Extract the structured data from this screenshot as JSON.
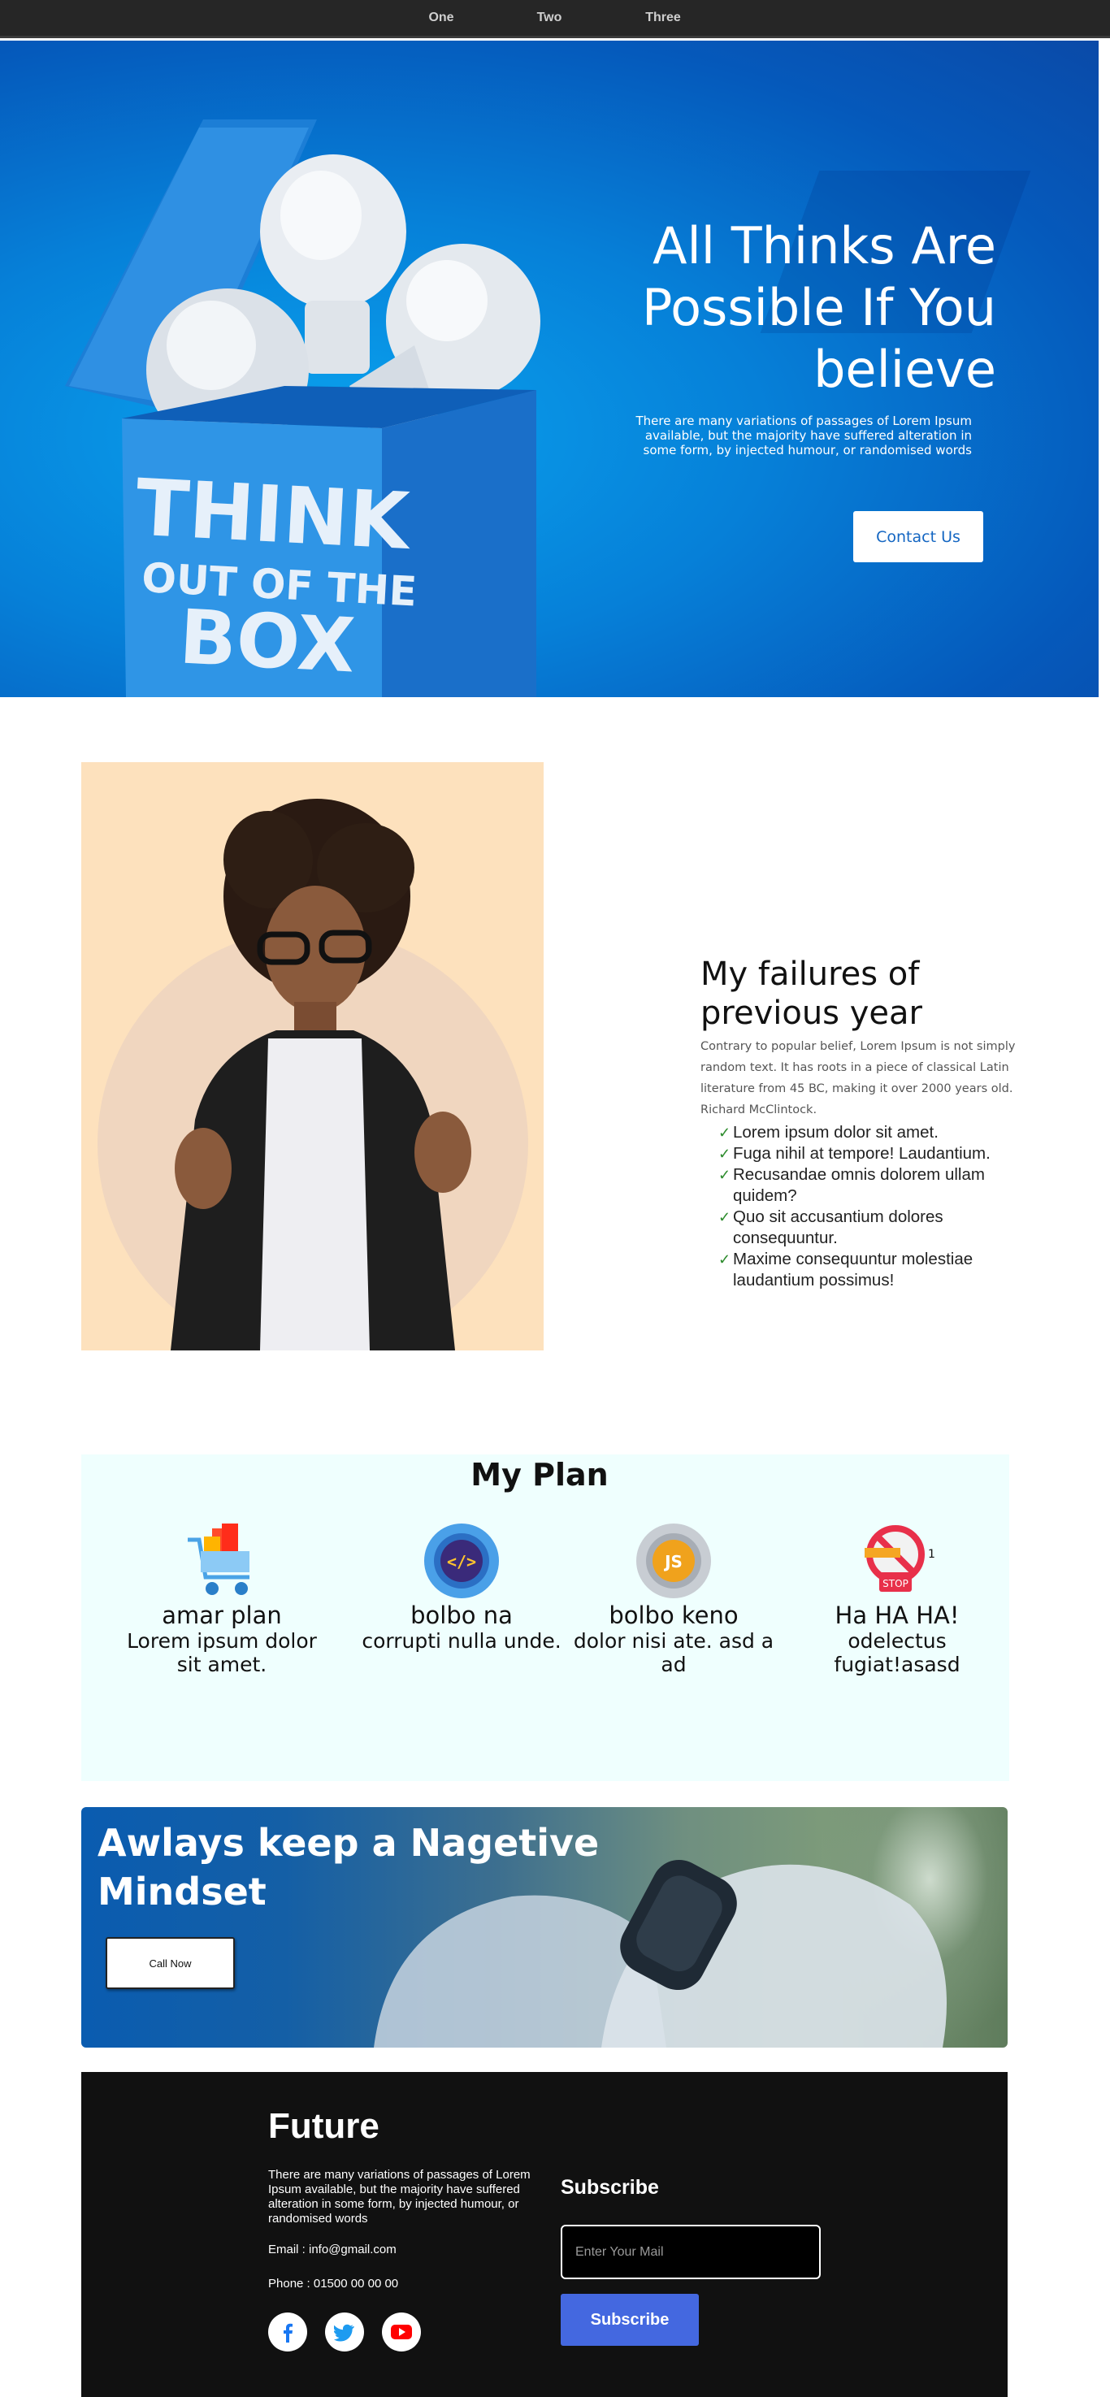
{
  "nav": {
    "items": [
      "One",
      "Two",
      "Three"
    ]
  },
  "hero": {
    "title": "All Thinks Are Possible If You believe",
    "description": "There are many variations of passages of Lorem Ipsum available, but the majority have suffered alteration in some form, by injected humour, or randomised words",
    "button_label": "Contact Us",
    "box_text": {
      "line1": "THINK",
      "line2": "OUT OF THE",
      "line3": "BOX"
    }
  },
  "failures": {
    "title": "My failures of previous year",
    "description": "Contrary to popular belief, Lorem Ipsum is not simply random text. It has roots in a piece of classical Latin literature from 45 BC, making it over 2000 years old. Richard McClintock.",
    "check_glyph": "✓",
    "items": [
      "Lorem ipsum dolor sit amet.",
      "Fuga nihil at tempore! Laudantium.",
      "Recusandae omnis dolorem ullam quidem?",
      "Quo sit accusantium dolores consequuntur.",
      "Maxime consequuntur molestiae laudantium possimus!"
    ]
  },
  "plan": {
    "title": "My Plan",
    "cards": [
      {
        "icon": "shopping-cart-icon",
        "name": "amar plan",
        "desc": "Lorem ipsum dolor sit amet."
      },
      {
        "icon": "code-gear-icon",
        "name": "bolbo na",
        "desc": "corrupti nulla unde."
      },
      {
        "icon": "js-gear-icon",
        "name": "bolbo keno",
        "desc": "dolor nisi ate. asd a ad"
      },
      {
        "icon": "stop-smoking-icon",
        "name": "Ha HA HA!",
        "desc": "odelectus fugiat!asasd",
        "icon_text": "STOP",
        "badge": "1"
      }
    ],
    "card_icon_text": {
      "code": "</>",
      "js": "JS"
    }
  },
  "banner": {
    "title": "Awlays keep a Nagetive Mindset",
    "button_label": "Call Now"
  },
  "footer": {
    "brand": "Future",
    "description": "There are many variations of passages of Lorem Ipsum available, but the majority have suffered alteration in some form, by injected humour, or randomised words",
    "email": "Email : info@gmail.com",
    "phone": "Phone : 01500 00 00 00",
    "social": [
      "facebook-icon",
      "twitter-icon",
      "youtube-icon"
    ],
    "subscribe_title": "Subscribe",
    "input_placeholder": "Enter Your Mail",
    "subscribe_button": "Subscribe"
  },
  "colors": {
    "nav_bg": "#262626",
    "hero_blue": "#0680d8",
    "peach": "#fde1bd",
    "plan_bg": "#effffe",
    "footer_bg": "#111111",
    "subscribe_btn": "#4468e0",
    "contact_text": "#1466c2",
    "check_green": "#2c8b2c"
  }
}
